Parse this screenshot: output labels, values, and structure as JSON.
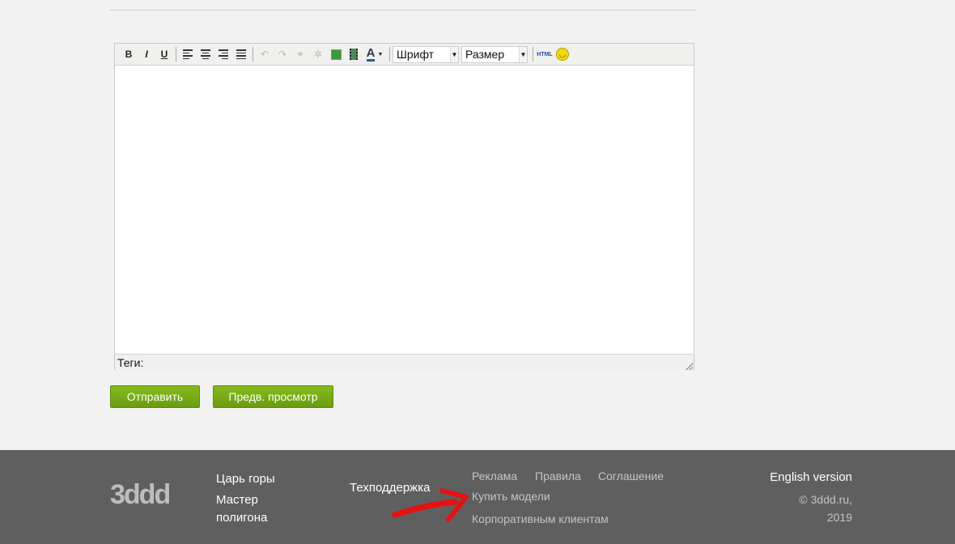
{
  "editor": {
    "font_select": "Шрифт",
    "size_select": "Размер",
    "html_button": "HTML",
    "tags_label": "Теги:"
  },
  "buttons": {
    "submit": "Отправить",
    "preview": "Предв. просмотр"
  },
  "footer": {
    "logo": "3ddd",
    "col1": [
      "Царь горы",
      "Мастер полигона"
    ],
    "support": "Техподдержка",
    "links_row": [
      "Реклама",
      "Правила",
      "Соглашение"
    ],
    "buy_models": "Купить модели",
    "corporate": "Корпоративным клиентам",
    "english": "English version",
    "copyright": "© 3ddd.ru,",
    "year": "2019"
  }
}
